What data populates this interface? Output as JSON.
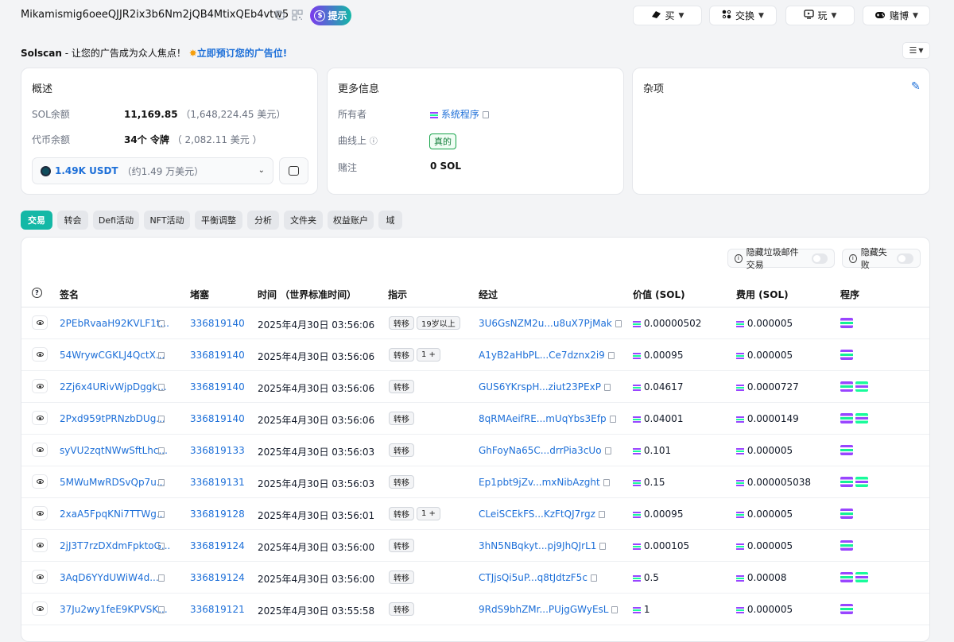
{
  "header": {
    "address": "Mikamismig6oeeQJJR2ix3b6Nm2jQB4MtixQEb4vtw5",
    "tip_label": "提示",
    "nav": [
      {
        "label": "买",
        "icon": "buy-icon"
      },
      {
        "label": "交换",
        "icon": "swap-icon"
      },
      {
        "label": "玩",
        "icon": "play-icon"
      },
      {
        "label": "赌博",
        "icon": "gamepad-icon"
      }
    ]
  },
  "promo": {
    "brand": "Solscan",
    "text": " - 让您的广告成为众人焦点！",
    "link": "立即预订您的广告位!"
  },
  "overview": {
    "title": "概述",
    "sol_label": "SOL余额",
    "sol_value": "11,169.85",
    "sol_usd": "（1,648,224.45 美元）",
    "token_label": "代币余额",
    "token_value": "34个 令牌",
    "token_usd": "（ 2,082.11 美元 ）",
    "selected_token": "1.49K USDT",
    "selected_token_usd": "（约1.49 万美元）"
  },
  "more_info": {
    "title": "更多信息",
    "owner_label": "所有者",
    "owner_value": "系统程序",
    "curve_label": "曲线上",
    "curve_value": "真的",
    "stake_label": "赌注",
    "stake_value": "0 SOL"
  },
  "misc": {
    "title": "杂项"
  },
  "tabs": [
    "交易",
    "转会",
    "Defi活动",
    "NFT活动",
    "平衡调整",
    "分析",
    "文件夹",
    "权益账户",
    "域"
  ],
  "filters": {
    "hide_spam": "隐藏垃圾邮件交易",
    "hide_failed": "隐藏失败"
  },
  "table": {
    "headers": [
      "签名",
      "堵塞",
      "时间 （世界标准时间）",
      "指示",
      "经过",
      "价值 (SOL)",
      "费用 (SOL)",
      "程序"
    ],
    "rows": [
      {
        "sig": "2PEbRvaaH92KVLF1t...",
        "block": "336819140",
        "time": "2025年4月30日 03:56:06",
        "instr": "转移",
        "extra": "19岁以上",
        "by": "3U6GsNZM2u...u8uX7PjMak",
        "value": "0.00000502",
        "fee": "0.000005",
        "progs": 1
      },
      {
        "sig": "54WrywCGKLJ4QctX...",
        "block": "336819140",
        "time": "2025年4月30日 03:56:06",
        "instr": "转移",
        "extra": "1 +",
        "by": "A1yB2aHbPL...Ce7dznx2i9",
        "value": "0.00095",
        "fee": "0.000005",
        "progs": 1
      },
      {
        "sig": "2Zj6x4URivWjpDggk...",
        "block": "336819140",
        "time": "2025年4月30日 03:56:06",
        "instr": "转移",
        "extra": "",
        "by": "GUS6YKrspH...ziut23PExP",
        "value": "0.04617",
        "fee": "0.0000727",
        "progs": 2
      },
      {
        "sig": "2Pxd959tPRNzbDUg...",
        "block": "336819140",
        "time": "2025年4月30日 03:56:06",
        "instr": "转移",
        "extra": "",
        "by": "8qRMAeifRE...mUqYbs3Efp",
        "value": "0.04001",
        "fee": "0.0000149",
        "progs": 2
      },
      {
        "sig": "syVU2zqtNWwSftLhc...",
        "block": "336819133",
        "time": "2025年4月30日 03:56:03",
        "instr": "转移",
        "extra": "",
        "by": "GhFoyNa65C...drrPia3cUo",
        "value": "0.101",
        "fee": "0.000005",
        "progs": 1
      },
      {
        "sig": "5MWuMwRDSvQp7u...",
        "block": "336819131",
        "time": "2025年4月30日 03:56:03",
        "instr": "转移",
        "extra": "",
        "by": "Ep1pbt9jZv...mxNibAzght",
        "value": "0.15",
        "fee": "0.000005038",
        "progs": 2
      },
      {
        "sig": "2xaA5FpqKNi7TTWg...",
        "block": "336819128",
        "time": "2025年4月30日 03:56:01",
        "instr": "转移",
        "extra": "1 +",
        "by": "CLeiSCEkFS...KzFtQJ7rgz",
        "value": "0.00095",
        "fee": "0.000005",
        "progs": 1
      },
      {
        "sig": "2jJ3T7rzDXdmFpktoG...",
        "block": "336819124",
        "time": "2025年4月30日 03:56:00",
        "instr": "转移",
        "extra": "",
        "by": "3hN5NBqkyt...pj9JhQJrL1",
        "value": "0.000105",
        "fee": "0.000005",
        "progs": 1
      },
      {
        "sig": "3AqD6YYdUWiW4d...",
        "block": "336819124",
        "time": "2025年4月30日 03:56:00",
        "instr": "转移",
        "extra": "",
        "by": "CTJjsQi5uP...q8tJdtzF5c",
        "value": "0.5",
        "fee": "0.00008",
        "progs": 2
      },
      {
        "sig": "37Ju2wy1feE9KPVSK...",
        "block": "336819121",
        "time": "2025年4月30日 03:55:58",
        "instr": "转移",
        "extra": "",
        "by": "9RdS9bhZMr...PUjgGWyEsL",
        "value": "1",
        "fee": "0.000005",
        "progs": 1
      }
    ]
  },
  "colors": {
    "accent": "#14b8a6",
    "link": "#1d6fd8",
    "sol_purple": "#9945ff",
    "sol_green": "#14f195"
  }
}
